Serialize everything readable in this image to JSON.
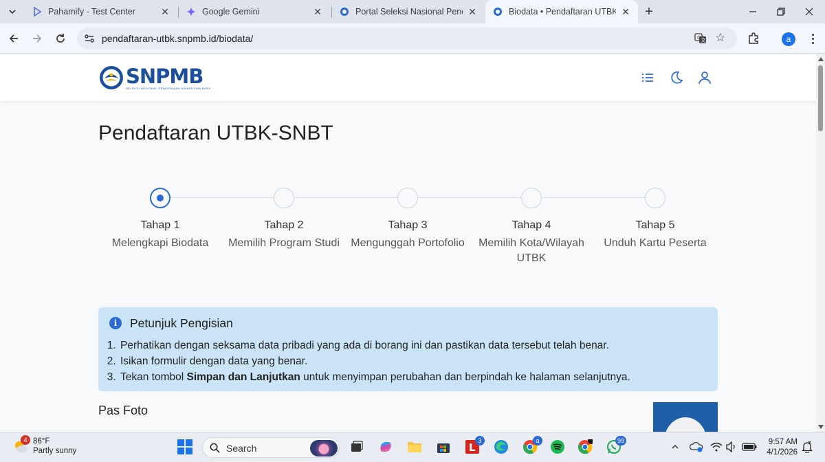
{
  "browser": {
    "tabs": [
      {
        "title": "Pahamify - Test Center",
        "favicon": "pahamify-icon",
        "active": false
      },
      {
        "title": "Google Gemini",
        "favicon": "gemini-icon",
        "active": false
      },
      {
        "title": "Portal Seleksi Nasional Penerim",
        "favicon": "snpmb-icon",
        "active": false
      },
      {
        "title": "Biodata • Pendaftaran UTBK-SN",
        "favicon": "snpmb-icon",
        "active": true
      }
    ],
    "url": "pendaftaran-utbk.snpmb.id/biodata/",
    "profile_initial": "a"
  },
  "site": {
    "logo_text": "SNPMB",
    "logo_subtext": "SELEKSI NASIONAL PENERIMAAN MAHASISWA BARU",
    "accent": "#2a6ad1"
  },
  "page": {
    "title": "Pendaftaran UTBK-SNBT",
    "steps": [
      {
        "label": "Tahap 1",
        "desc": "Melengkapi Biodata",
        "current": true
      },
      {
        "label": "Tahap 2",
        "desc": "Memilih Program Studi",
        "current": false
      },
      {
        "label": "Tahap 3",
        "desc": "Mengunggah Portofolio",
        "current": false
      },
      {
        "label": "Tahap 4",
        "desc": "Memilih Kota/Wilayah UTBK",
        "current": false
      },
      {
        "label": "Tahap 5",
        "desc": "Unduh Kartu Peserta",
        "current": false
      }
    ],
    "instructions": {
      "title": "Petunjuk Pengisian",
      "item1": "Perhatikan dengan seksama data pribadi yang ada di borang ini dan pastikan data tersebut telah benar.",
      "item2": "Isikan formulir dengan data yang benar.",
      "item3_prefix": "Tekan tombol ",
      "item3_bold": "Simpan dan Lanjutkan",
      "item3_suffix": " untuk menyimpan perubahan dan berpindah ke halaman selanjutnya."
    },
    "photo_section_label": "Pas Foto"
  },
  "taskbar": {
    "weather_temp": "86°F",
    "weather_desc": "Partly sunny",
    "weather_badge": "4",
    "search_label": "Search",
    "badge_l": "3",
    "badge_chrome": "a",
    "badge_whatsapp": "99",
    "time": "9:57 AM",
    "date": "4/1/2026"
  }
}
